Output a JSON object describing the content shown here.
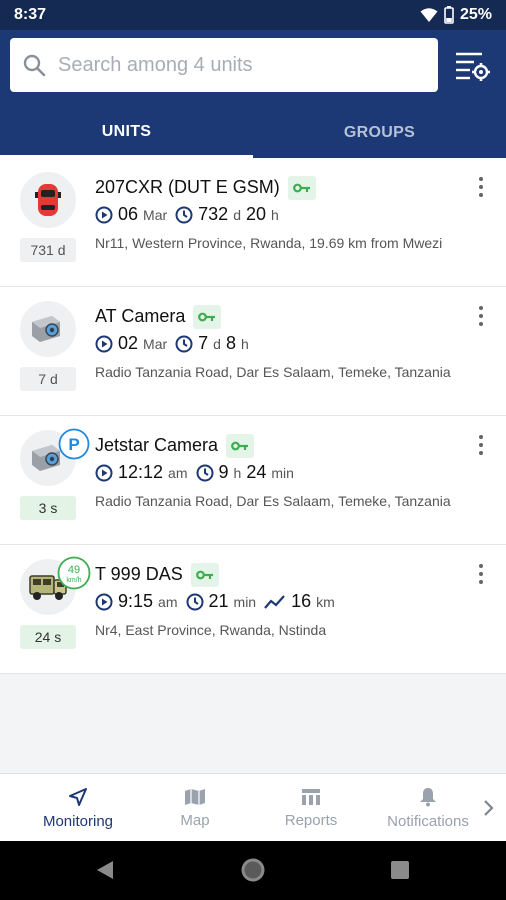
{
  "status_bar": {
    "time": "8:37",
    "battery": "25%"
  },
  "search": {
    "placeholder": "Search among 4 units"
  },
  "tabs": [
    {
      "label": "UNITS",
      "active": true
    },
    {
      "label": "GROUPS",
      "active": false
    }
  ],
  "units": [
    {
      "name": "207CXR (DUT E GSM)",
      "icon": "car-icon",
      "badge": "731 d",
      "stats": [
        {
          "icon": "play-circle-icon",
          "value": "06",
          "unit": "Mar"
        },
        {
          "icon": "clock-icon",
          "value": "732",
          "unit": "d",
          "value2": "20",
          "unit2": "h"
        }
      ],
      "address": "Nr11, Western Province, Rwanda, 19.69 km from Mwezi"
    },
    {
      "name": "AT Camera",
      "icon": "camera-icon",
      "badge": "7 d",
      "stats": [
        {
          "icon": "play-circle-icon",
          "value": "02",
          "unit": "Mar"
        },
        {
          "icon": "clock-icon",
          "value": "7",
          "unit": "d",
          "value2": "8",
          "unit2": "h"
        }
      ],
      "address": "Radio Tanzania Road, Dar Es Salaam, Temeke, Tanzania"
    },
    {
      "name": "Jetstar Camera",
      "icon": "camera-icon",
      "overlay": "P",
      "badge": "3 s",
      "stats": [
        {
          "icon": "play-circle-icon",
          "value": "12:12",
          "unit": "am"
        },
        {
          "icon": "clock-icon",
          "value": "9",
          "unit": "h",
          "value2": "24",
          "unit2": "min"
        }
      ],
      "address": "Radio Tanzania Road, Dar Es Salaam, Temeke, Tanzania"
    },
    {
      "name": "T 999 DAS",
      "icon": "truck-icon",
      "speed_value": "49",
      "speed_unit": "km/h",
      "badge": "24 s",
      "stats": [
        {
          "icon": "play-circle-icon",
          "value": "9:15",
          "unit": "am"
        },
        {
          "icon": "clock-icon",
          "value": "21",
          "unit": "min"
        },
        {
          "icon": "trend-icon",
          "value": "16",
          "unit": "km"
        }
      ],
      "address": "Nr4, East Province, Rwanda, Nstinda"
    }
  ],
  "bottom_nav": [
    {
      "label": "Monitoring",
      "icon": "navigation-arrow-icon",
      "active": true
    },
    {
      "label": "Map",
      "icon": "map-icon",
      "active": false
    },
    {
      "label": "Reports",
      "icon": "reports-icon",
      "active": false
    },
    {
      "label": "Notifications",
      "icon": "bell-icon",
      "active": false
    }
  ],
  "colors": {
    "header": "#1c3875",
    "status_bar": "#152a52",
    "accent_green": "#3cae4f",
    "active_nav": "#1c3875"
  }
}
